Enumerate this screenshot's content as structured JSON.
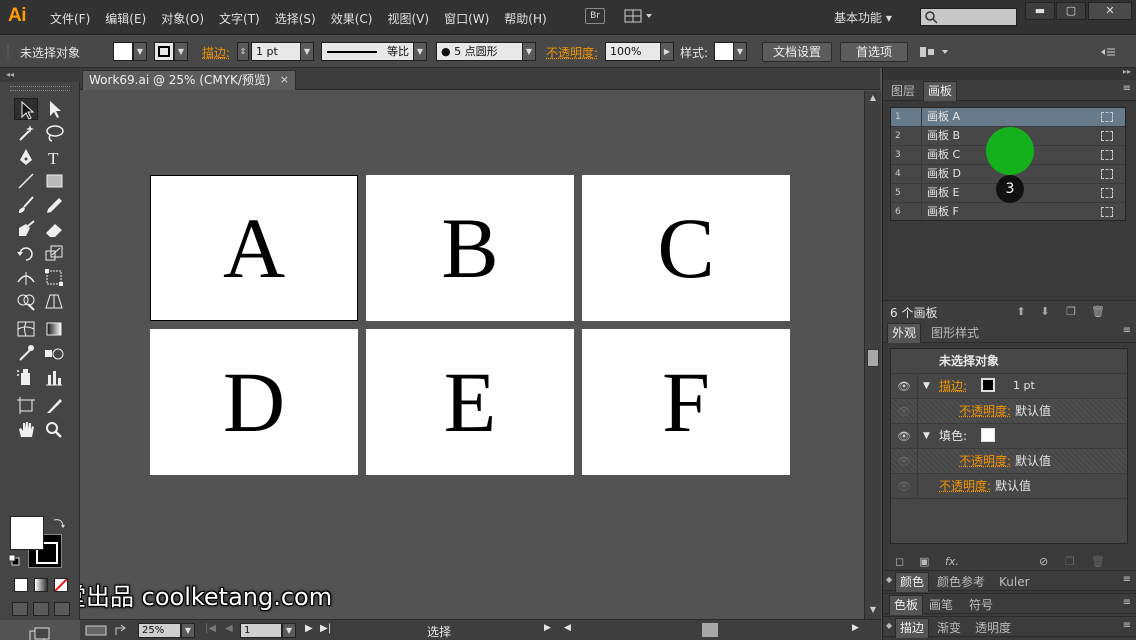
{
  "app": {
    "logo": "Ai",
    "menu": [
      "文件(F)",
      "编辑(E)",
      "对象(O)",
      "文字(T)",
      "选择(S)",
      "效果(C)",
      "视图(V)",
      "窗口(W)",
      "帮助(H)"
    ],
    "bridge_label": "Br",
    "workspace": "基本功能 ▾",
    "window_min": "▬",
    "window_max": "▢",
    "window_close": "✕"
  },
  "control_bar": {
    "selection_status": "未选择对象",
    "stroke_label": "描边:",
    "stroke_weight": "1 pt",
    "profile_label": "等比",
    "brush_label": "●  5 点圆形",
    "opacity_label": "不透明度:",
    "opacity_value": "100%",
    "style_label": "样式:",
    "doc_setup_button": "文档设置",
    "prefs_button": "首选项"
  },
  "document": {
    "tab_title": "Work69.ai @ 25% (CMYK/预览)",
    "tab_close": "×",
    "artboards": [
      "A",
      "B",
      "C",
      "D",
      "E",
      "F"
    ],
    "active_artboard": "A"
  },
  "status_bar": {
    "zoom": "25%",
    "artboard_nav": "1",
    "tool_status": "选择"
  },
  "artboards_panel": {
    "tabs": [
      "图层",
      "画板"
    ],
    "active_tab": "画板",
    "rows": [
      {
        "num": "1",
        "name": "画板  A"
      },
      {
        "num": "2",
        "name": "画板  B"
      },
      {
        "num": "3",
        "name": "画板  C"
      },
      {
        "num": "4",
        "name": "画板  D"
      },
      {
        "num": "5",
        "name": "画板  E"
      },
      {
        "num": "6",
        "name": "画板  F"
      }
    ],
    "selected_row": "1",
    "count_label": "6 个画板",
    "click_badge": "3"
  },
  "appearance_panel": {
    "tabs": [
      "外观",
      "图形样式"
    ],
    "active_tab": "外观",
    "title": "未选择对象",
    "stroke_label": "描边:",
    "stroke_value": "1 pt",
    "opacity_label": "不透明度:",
    "default_value": "默认值",
    "fill_label": "填色:",
    "fx_label": "fx."
  },
  "lower_panels": {
    "row1": [
      "颜色",
      "颜色参考",
      "Kuler"
    ],
    "row2": [
      "色板",
      "画笔",
      "符号"
    ],
    "row3": [
      "描边",
      "渐变",
      "透明度"
    ]
  },
  "watermark": "酷课堂出品 coolketang.com",
  "colors": {
    "accent_orange": "#f29400",
    "selected_row": "#677a8a",
    "cursor_highlight": "#14b11c"
  }
}
